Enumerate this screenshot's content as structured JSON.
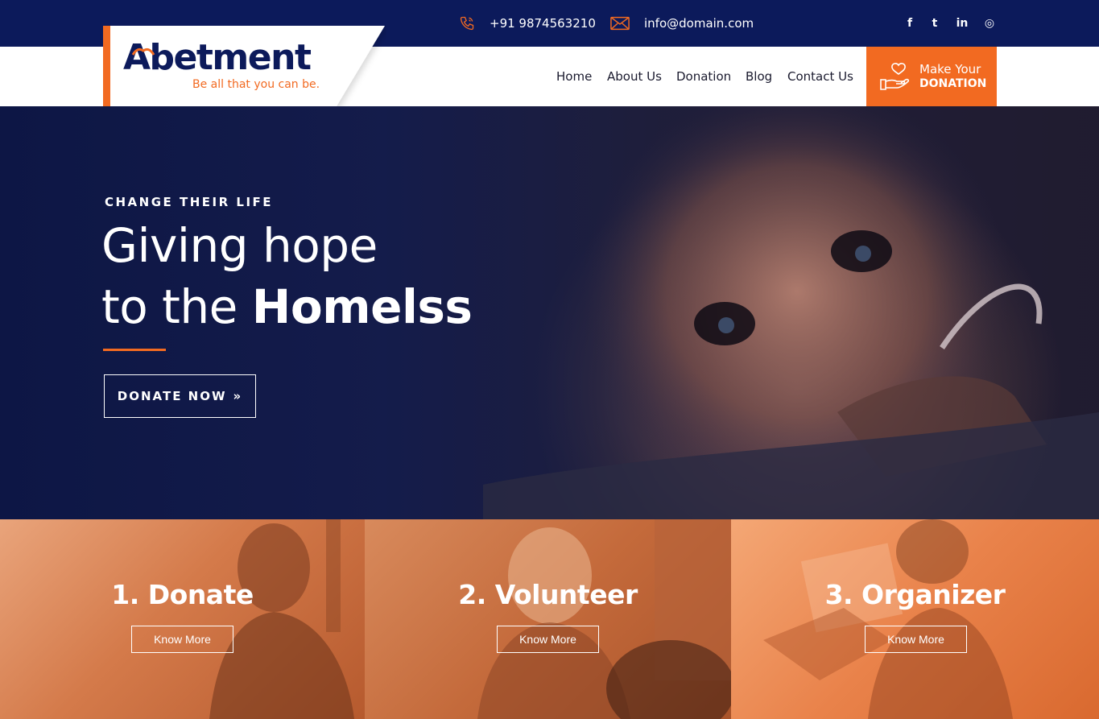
{
  "topbar": {
    "phone": "+91 9874563210",
    "email": "info@domain.com",
    "phone_icon": "phone-icon",
    "email_icon": "envelope-icon",
    "social": [
      {
        "name": "facebook",
        "glyph": "f"
      },
      {
        "name": "twitter",
        "glyph": "t"
      },
      {
        "name": "linkedin",
        "glyph": "in"
      },
      {
        "name": "instagram",
        "glyph": "◎"
      }
    ]
  },
  "brand": {
    "name": "Abetment",
    "tagline": "Be all that you can be.",
    "primary_color": "#0c1a5b",
    "accent_color": "#f26a21"
  },
  "nav": {
    "items": [
      "Home",
      "About Us",
      "Donation",
      "Blog",
      "Contact Us"
    ],
    "cta_line1": "Make Your",
    "cta_line2": "DONATION",
    "cta_icon": "hand-heart-icon"
  },
  "hero": {
    "eyebrow": "CHANGE THEIR LIFE",
    "line1": "Giving hope",
    "line2_prefix": "to the ",
    "line2_bold": "Homelss",
    "button_label": "DONATE NOW",
    "button_icon": "double-chevron-right-icon"
  },
  "cards": [
    {
      "title": "1. Donate",
      "button": "Know More"
    },
    {
      "title": "2. Volunteer",
      "button": "Know More"
    },
    {
      "title": "3. Organizer",
      "button": "Know More"
    }
  ]
}
